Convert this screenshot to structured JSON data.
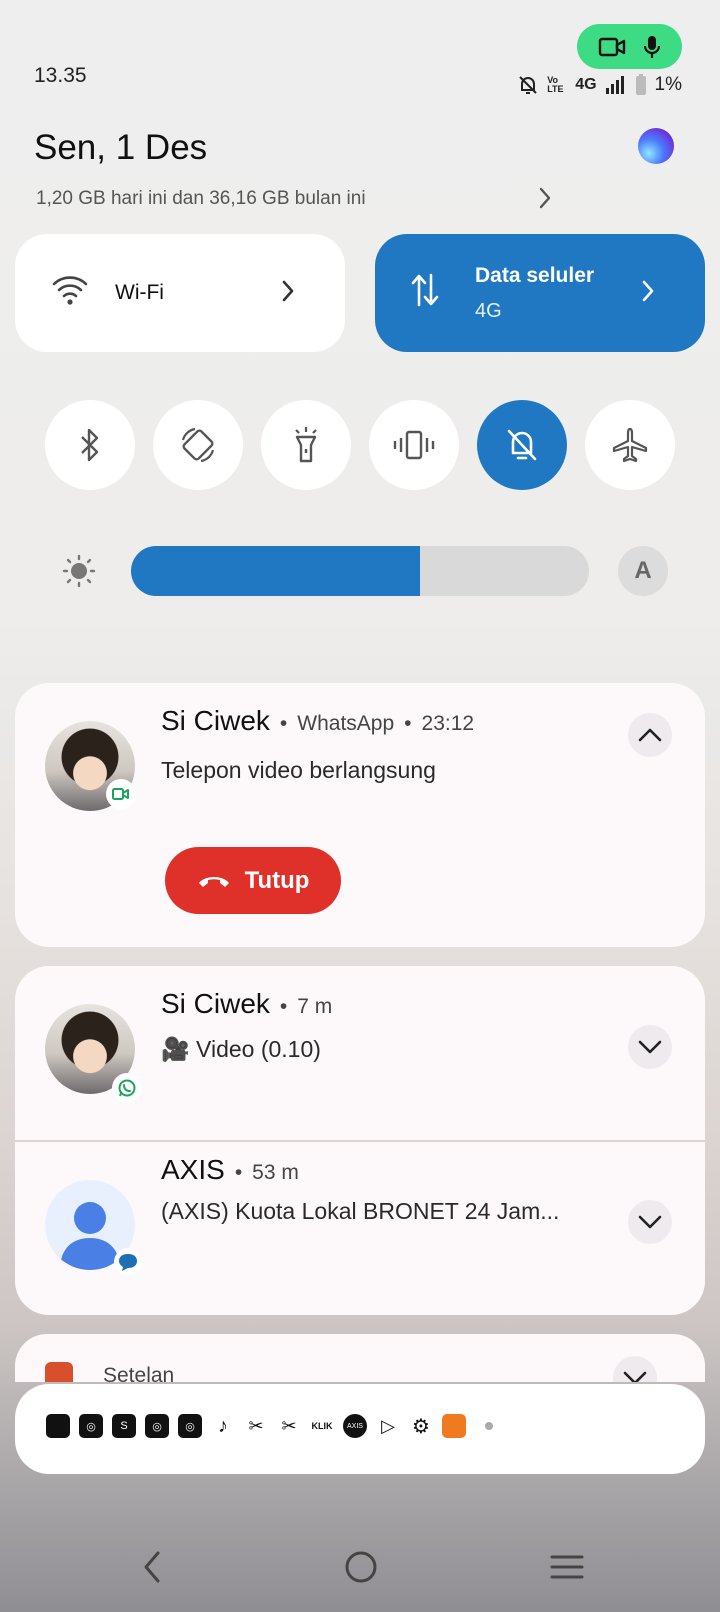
{
  "status_bar": {
    "time": "13.35",
    "volte": "Vo LTE",
    "network": "4G",
    "battery": "1%"
  },
  "header": {
    "date": "Sen, 1 Des",
    "usage": "1,20 GB hari ini dan 36,16 GB bulan ini"
  },
  "tiles": {
    "wifi": {
      "label": "Wi-Fi"
    },
    "data": {
      "label": "Data seluler",
      "sub": "4G"
    }
  },
  "toggles": [
    {
      "name": "bluetooth-icon",
      "on": false
    },
    {
      "name": "auto-rotate-icon",
      "on": false
    },
    {
      "name": "flashlight-icon",
      "on": false
    },
    {
      "name": "vibrate-icon",
      "on": false
    },
    {
      "name": "silent-bell-icon",
      "on": true
    },
    {
      "name": "airplane-icon",
      "on": false
    }
  ],
  "brightness": {
    "level": 0.63,
    "auto_label": "A"
  },
  "notifications": {
    "call": {
      "title": "Si Ciwek",
      "app": "WhatsApp",
      "time": "23:12",
      "body": "Telepon video berlangsung",
      "action": "Tutup"
    },
    "chat": {
      "title": "Si Ciwek",
      "time": "7 m",
      "body": "🎥 Video (0.10)"
    },
    "sms": {
      "title": "AXIS",
      "time": "53 m",
      "body": "(AXIS) Kuota Lokal BRONET 24 Jam..."
    },
    "settings": {
      "title": "Setelan"
    }
  },
  "tray_apps": [
    "S",
    "KLIK",
    "AXIS"
  ],
  "colors": {
    "accent": "#1f78c1",
    "hangup": "#e0302a",
    "record": "#3ddc84"
  }
}
